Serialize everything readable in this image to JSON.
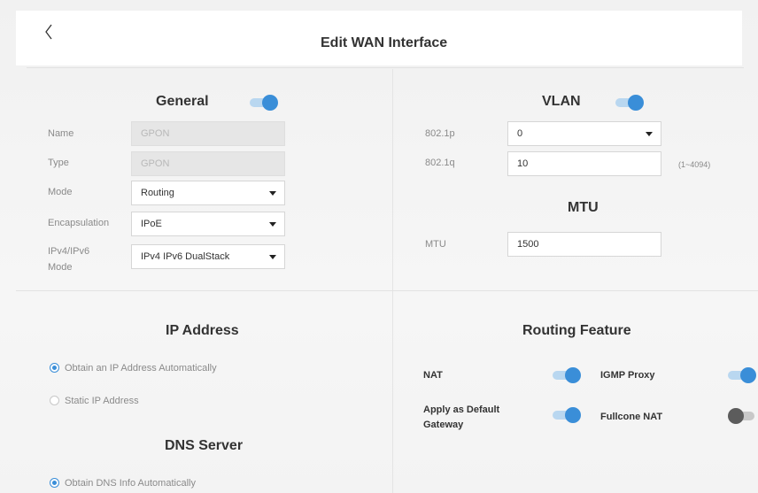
{
  "header": {
    "title": "Edit WAN Interface",
    "back_icon": "chevron-left-icon"
  },
  "general": {
    "title": "General",
    "enabled": true,
    "name": {
      "label": "Name",
      "value": "GPON"
    },
    "type": {
      "label": "Type",
      "value": "GPON"
    },
    "mode": {
      "label": "Mode",
      "value": "Routing"
    },
    "encapsulation": {
      "label": "Encapsulation",
      "value": "IPoE"
    },
    "ip_mode": {
      "label_line1": "IPv4/IPv6",
      "label_line2": "Mode",
      "value": "IPv4 IPv6 DualStack"
    }
  },
  "vlan": {
    "title": "VLAN",
    "enabled": true,
    "p8021": {
      "label": "802.1p",
      "value": "0"
    },
    "q8021": {
      "label": "802.1q",
      "value": "10",
      "hint": "(1~4094)"
    }
  },
  "mtu": {
    "title": "MTU",
    "label": "MTU",
    "value": "1500"
  },
  "ip_address": {
    "title": "IP Address",
    "options": [
      {
        "label": "Obtain an IP Address Automatically",
        "checked": true
      },
      {
        "label": "Static IP Address",
        "checked": false
      }
    ]
  },
  "dns": {
    "title": "DNS Server",
    "options": [
      {
        "label": "Obtain DNS Info Automatically",
        "checked": true
      }
    ]
  },
  "routing": {
    "title": "Routing Feature",
    "nat": {
      "label": "NAT",
      "enabled": true
    },
    "igmp": {
      "label": "IGMP Proxy",
      "enabled": true
    },
    "default_gw": {
      "label_line1": "Apply as Default",
      "label_line2": "Gateway",
      "enabled": true
    },
    "fullcone": {
      "label": "Fullcone NAT",
      "enabled": false
    }
  },
  "colors": {
    "accent": "#3a8ed8",
    "toggle_on_track": "#b9d7f0",
    "toggle_off_knob": "#5c5c5c"
  }
}
